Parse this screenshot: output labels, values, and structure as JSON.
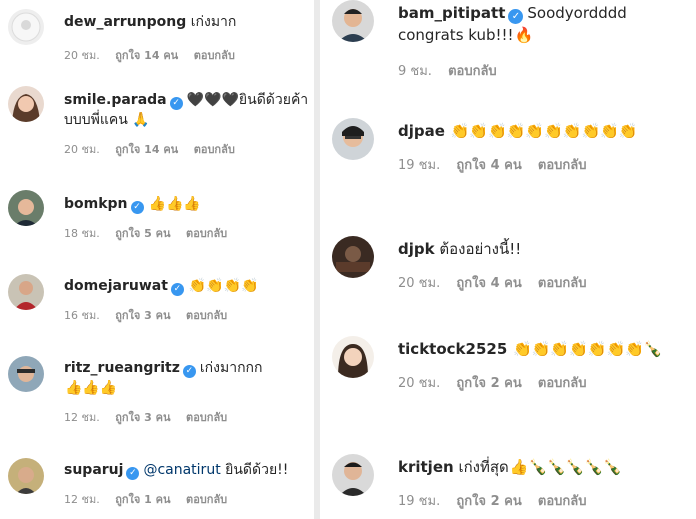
{
  "left_comments": [
    {
      "username": "dew_arrunpong",
      "verified": false,
      "mention": "",
      "text": "เก่งมาก",
      "emoji": "",
      "time": "20 ชม.",
      "likes": "ถูกใจ 14 คน",
      "reply": "ตอบกลับ"
    },
    {
      "username": "smile.parada",
      "verified": true,
      "mention": "",
      "text": "🖤🖤🖤ยินดีด้วยค้าบบบพี่แคน 🙏",
      "emoji": "",
      "time": "20 ชม.",
      "likes": "ถูกใจ 14 คน",
      "reply": "ตอบกลับ"
    },
    {
      "username": "bomkpn",
      "verified": true,
      "mention": "",
      "text": "",
      "emoji": "👍👍👍",
      "time": "18 ชม.",
      "likes": "ถูกใจ 5 คน",
      "reply": "ตอบกลับ"
    },
    {
      "username": "domejaruwat",
      "verified": true,
      "mention": "",
      "text": "",
      "emoji": "👏👏👏👏",
      "time": "16 ชม.",
      "likes": "ถูกใจ 3 คน",
      "reply": "ตอบกลับ"
    },
    {
      "username": "ritz_rueangritz",
      "verified": true,
      "mention": "",
      "text": "เก่งมากกก",
      "emoji": "👍👍👍",
      "time": "12 ชม.",
      "likes": "ถูกใจ 3 คน",
      "reply": "ตอบกลับ"
    },
    {
      "username": "suparuj",
      "verified": true,
      "mention": "@canatirut",
      "text": "ยินดีด้วย!!",
      "emoji": "",
      "time": "12 ชม.",
      "likes": "ถูกใจ 1 คน",
      "reply": "ตอบกลับ"
    }
  ],
  "right_comments": [
    {
      "username": "bam_pitipatt",
      "verified": true,
      "mention": "",
      "text": "Soodyordddd congrats kub!!!",
      "emoji": "🔥",
      "time": "9 ชม.",
      "likes": "",
      "reply": "ตอบกลับ"
    },
    {
      "username": "djpae",
      "verified": false,
      "mention": "",
      "text": "",
      "emoji": "👏👏👏👏👏👏👏👏👏👏",
      "time": "19 ชม.",
      "likes": "ถูกใจ 4 คน",
      "reply": "ตอบกลับ"
    },
    {
      "username": "djpk",
      "verified": false,
      "mention": "",
      "text": "ต้องอย่างนี้!!",
      "emoji": "",
      "time": "20 ชม.",
      "likes": "ถูกใจ 4 คน",
      "reply": "ตอบกลับ"
    },
    {
      "username": "ticktock2525",
      "verified": false,
      "mention": "",
      "text": "",
      "emoji": "👏👏👏👏👏👏👏🍾",
      "time": "20 ชม.",
      "likes": "ถูกใจ 2 คน",
      "reply": "ตอบกลับ"
    },
    {
      "username": "kritjen",
      "verified": false,
      "mention": "",
      "text": "เก่งที่สุด",
      "emoji": "👍🍾🍾🍾🍾🍾",
      "time": "19 ชม.",
      "likes": "ถูกใจ 2 คน",
      "reply": "ตอบกลับ"
    }
  ],
  "colors": {
    "verified": "#3897f0",
    "meta_text": "#8e8e8e",
    "mention": "#00376b",
    "text": "#262626"
  },
  "icons": {
    "verified": "verified-badge-icon",
    "reply": "reply-link"
  }
}
